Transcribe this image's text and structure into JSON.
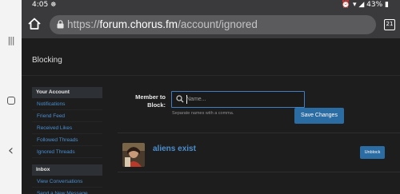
{
  "status_bar": {
    "time": "4:05",
    "battery": "43%"
  },
  "browser": {
    "url_scheme": "https://",
    "url_host": "forum.chorus.fm",
    "url_path": "/account/ignored",
    "tab_count": "21"
  },
  "page": {
    "title": "Blocking",
    "sidebar": {
      "sections": [
        {
          "heading": "Your Account",
          "items": [
            "Notifications",
            "Friend Feed",
            "Received Likes",
            "Followed Threads",
            "Ignored Threads"
          ]
        },
        {
          "heading": "Inbox",
          "items": [
            "View Conversations",
            "Send a New Message"
          ]
        }
      ]
    },
    "form": {
      "label": "Member to Block:",
      "input_placeholder": "Name...",
      "hint": "Separate names with a comma.",
      "save_label": "Save Changes"
    },
    "blocked_users": [
      {
        "name": "aliens exist",
        "unblock_label": "Unblock"
      }
    ]
  },
  "colors": {
    "accent": "#2b6ca3",
    "link": "#4b8fcf",
    "background": "#1d1d1e"
  }
}
